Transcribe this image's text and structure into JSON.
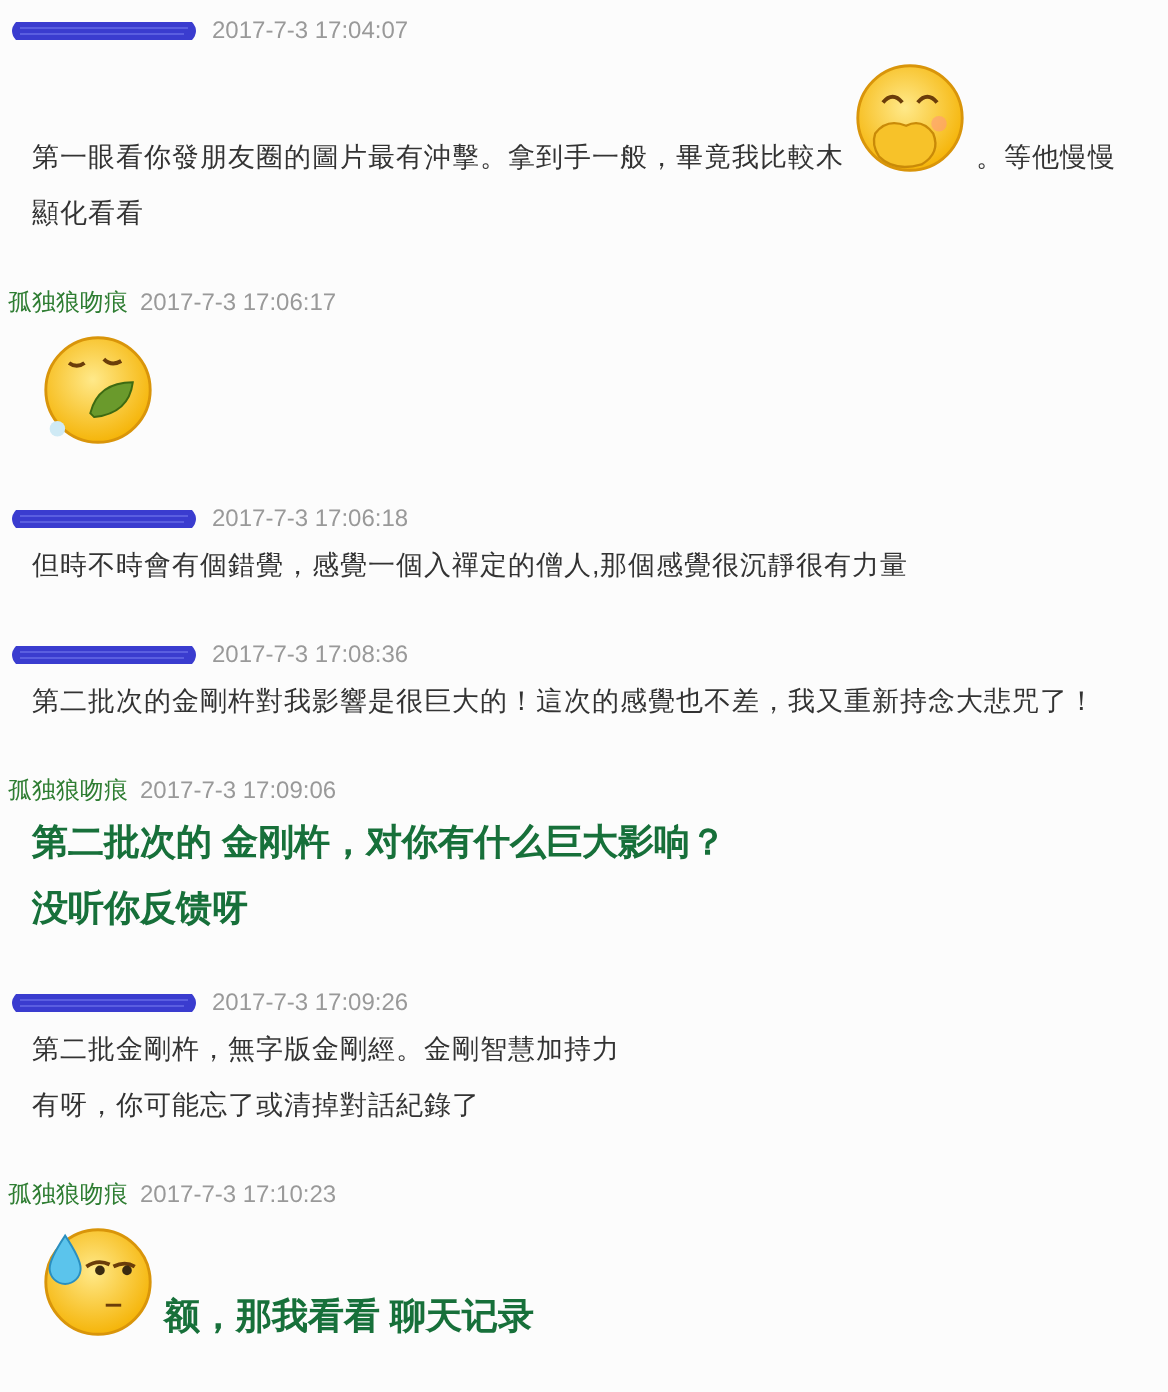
{
  "messages": [
    {
      "sender": {
        "kind": "redacted"
      },
      "time": "2017-7-3 17:04:07",
      "lines": [
        {
          "kind": "normal",
          "parts": [
            {
              "kind": "text",
              "text": "第一眼看你發朋友圈的圖片最有沖擊。拿到手一般，畢竟我比較木"
            },
            {
              "kind": "emoji"
            },
            {
              "kind": "text",
              "text": "。等他慢慢"
            }
          ]
        },
        {
          "kind": "normal",
          "parts": [
            {
              "kind": "text",
              "text": "顯化看看"
            }
          ]
        }
      ]
    },
    {
      "sender": {
        "kind": "name",
        "text": "孤独狼吻痕"
      },
      "time": "2017-7-3 17:06:17",
      "lines": [
        {
          "kind": "normal",
          "parts": [
            {
              "kind": "emoji"
            }
          ]
        }
      ]
    },
    {
      "sender": {
        "kind": "redacted"
      },
      "time": "2017-7-3 17:06:18",
      "lines": [
        {
          "kind": "normal",
          "parts": [
            {
              "kind": "text",
              "text": "但時不時會有個錯覺，感覺一個入禪定的僧人,那個感覺很沉靜很有力量"
            }
          ]
        }
      ]
    },
    {
      "sender": {
        "kind": "redacted"
      },
      "time": "2017-7-3 17:08:36",
      "lines": [
        {
          "kind": "normal",
          "parts": [
            {
              "kind": "text",
              "text": "第二批次的金剛杵對我影響是很巨大的！這次的感覺也不差，我又重新持念大悲咒了！"
            }
          ]
        }
      ]
    },
    {
      "sender": {
        "kind": "name",
        "text": "孤独狼吻痕"
      },
      "time": "2017-7-3 17:09:06",
      "lines": [
        {
          "kind": "large",
          "parts": [
            {
              "kind": "text",
              "text": "第二批次的 金刚杵，对你有什么巨大影响？"
            }
          ]
        },
        {
          "kind": "large",
          "parts": [
            {
              "kind": "text",
              "text": "没听你反馈呀"
            }
          ]
        }
      ]
    },
    {
      "sender": {
        "kind": "redacted"
      },
      "time": "2017-7-3 17:09:26",
      "lines": [
        {
          "kind": "normal",
          "parts": [
            {
              "kind": "text",
              "text": "第二批金剛杵，無字版金剛經。金剛智慧加持力"
            }
          ]
        },
        {
          "kind": "normal",
          "parts": [
            {
              "kind": "text",
              "text": "有呀，你可能忘了或清掉對話紀錄了"
            }
          ]
        }
      ]
    },
    {
      "sender": {
        "kind": "name",
        "text": "孤独狼吻痕"
      },
      "time": "2017-7-3 17:10:23",
      "lines": [
        {
          "kind": "large",
          "parts": [
            {
              "kind": "emoji"
            },
            {
              "kind": "text",
              "text": "额，那我看看 聊天记录"
            }
          ]
        }
      ]
    }
  ]
}
